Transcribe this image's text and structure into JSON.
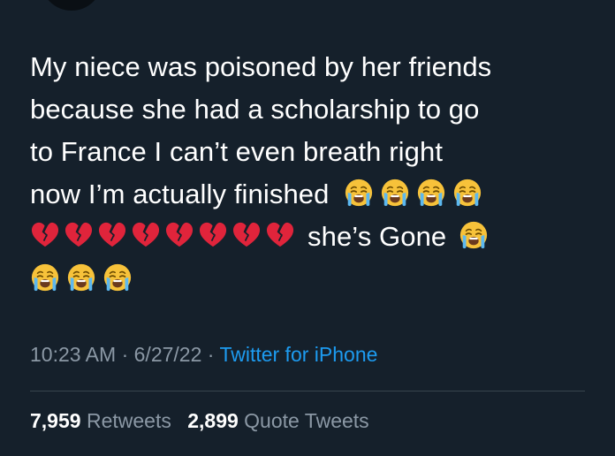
{
  "tweet": {
    "lines": [
      "My niece was poisoned by her friends",
      "because she had a scholarship to go",
      "to France I can’t even breath right",
      "now I’m actually finished"
    ],
    "after_hearts": "she’s Gone"
  },
  "emoji": {
    "crying": "loudly-crying-face",
    "heart": "broken-heart",
    "line4_crying_count": 4,
    "hearts_count": 8,
    "line5_crying_count": 1,
    "line6_crying_count": 3
  },
  "meta": {
    "time": "10:23 AM",
    "separator": "·",
    "date": "6/27/22",
    "source": "Twitter for iPhone"
  },
  "stats": {
    "retweets_count": "7,959",
    "retweets_label": "Retweets",
    "quotes_count": "2,899",
    "quotes_label": "Quote Tweets"
  },
  "colors": {
    "background": "#15202b",
    "text": "#ffffff",
    "muted": "#8b98a5",
    "link": "#1d9bf0",
    "divider": "#38444d",
    "heart": "#e0243b",
    "emoji_face": "#f7c23a",
    "tears": "#5cb8f0"
  }
}
